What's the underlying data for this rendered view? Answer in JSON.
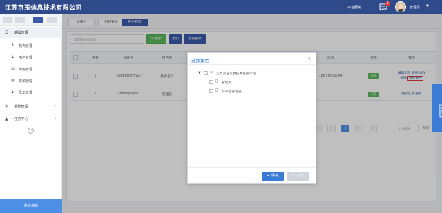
{
  "header": {
    "company": "江苏京玉信息技术有限公司",
    "platform_service": "平台服务",
    "message_count": "1",
    "user_name": "管理员",
    "caret": "▼"
  },
  "sidebar": {
    "menu_group_label": "基础管理",
    "sub_items": [
      {
        "label": "机构管理",
        "icon": "org-icon"
      },
      {
        "label": "用户管理",
        "icon": "users-icon"
      },
      {
        "label": "角色管理",
        "icon": "role-icon"
      },
      {
        "label": "菜单管理",
        "icon": "menu-icon"
      },
      {
        "label": "员工管理",
        "icon": "employee-icon"
      }
    ],
    "system_label": "系统管理",
    "task_label": "任务中心",
    "bottom_label": "系统体验"
  },
  "tabs": [
    {
      "label": "工作台"
    },
    {
      "label": "机构管理"
    },
    {
      "label": "用户管理"
    }
  ],
  "toolbar": {
    "search_placeholder": "运营输入关键词",
    "search_label": "搜索",
    "add_label": "添加",
    "batch_delete_label": "批量删除"
  },
  "table": {
    "headers": [
      "序号",
      "登录名",
      "用户名",
      "电话",
      "状态",
      "操作"
    ],
    "rows": [
      {
        "index": "1",
        "login": "supportjingyu",
        "username": "技术员工",
        "phone": "18677656784",
        "status": "有效",
        "ops_line1": "编辑信息 查看 修改",
        "ops_line2_prefix": "删除",
        "ops_line2_highlight": "授权角色"
      },
      {
        "index": "2",
        "login": "adminjingyu",
        "username": "管理员",
        "phone": "",
        "status": "有效",
        "ops_line1": "编辑信息 删除",
        "ops_line2_prefix": "",
        "ops_line2_highlight": ""
      }
    ]
  },
  "pager": {
    "current_page": "1",
    "info": "1/1共2条",
    "page_size": "5/页"
  },
  "side_tab_label": "获取帮助",
  "modal": {
    "title": "选择角色",
    "close": "×",
    "tree": {
      "root": "江苏京玉信息技术有限公司",
      "children": [
        "管理员",
        "云平台管理员"
      ]
    },
    "save_label": "保存",
    "close_label": "关闭"
  },
  "colors": {
    "brand": "#2f4a8a",
    "accent": "#3a5aa8",
    "success": "#5cb85c",
    "highlight": "#e53935"
  }
}
